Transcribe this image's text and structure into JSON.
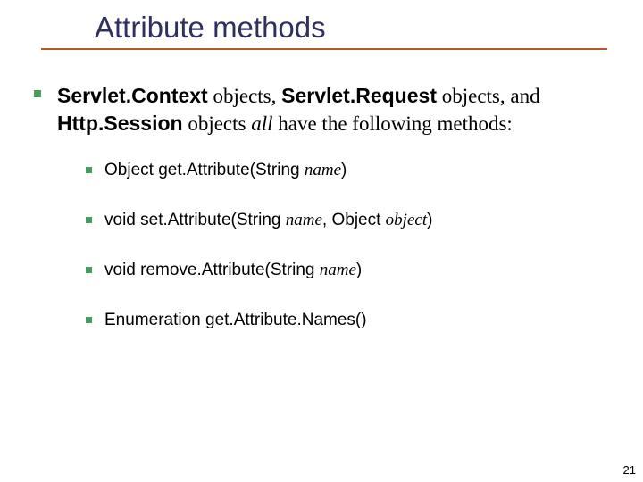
{
  "title": "Attribute methods",
  "intro": {
    "t1": "Servlet.Context",
    "t2": " objects, ",
    "t3": "Servlet.Request",
    "t4": " objects, and ",
    "t5": "Http.Session",
    "t6": " objects ",
    "t7": "all",
    "t8": " have the following methods:"
  },
  "methods": {
    "m1a": "Object get.Attribute(String ",
    "m1b": "name",
    "m1c": ")",
    "m2a": "void set.Attribute(String ",
    "m2b": "name",
    "m2c": ", Object ",
    "m2d": "object",
    "m2e": ")",
    "m3a": "void remove.Attribute(String ",
    "m3b": "name",
    "m3c": ")",
    "m4": "Enumeration get.Attribute.Names()"
  },
  "pagenum": "21"
}
